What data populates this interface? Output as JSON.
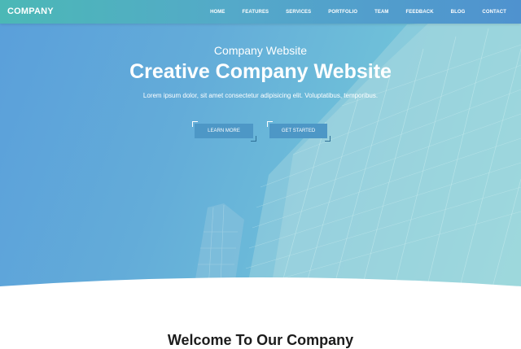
{
  "header": {
    "logo": "COMPANY",
    "nav": [
      "HOME",
      "FEATURES",
      "SERVICES",
      "PORTFOLIO",
      "TEAM",
      "FEEDBACK",
      "BLOG",
      "CONTACT"
    ]
  },
  "hero": {
    "subtitle": "Company Website",
    "title": "Creative Company Website",
    "lead": "Lorem ipsum dolor, sit amet consectetur adipisicing elit. Voluptatibus, temporibus.",
    "learn_more": "LEARN MORE",
    "get_started": "GET STARTED"
  },
  "section": {
    "title": "Welcome To Our Company"
  },
  "colors": {
    "nav_gradient_start": "#4bb8b6",
    "nav_gradient_end": "#4f92cf",
    "button": "#4d97c6"
  }
}
